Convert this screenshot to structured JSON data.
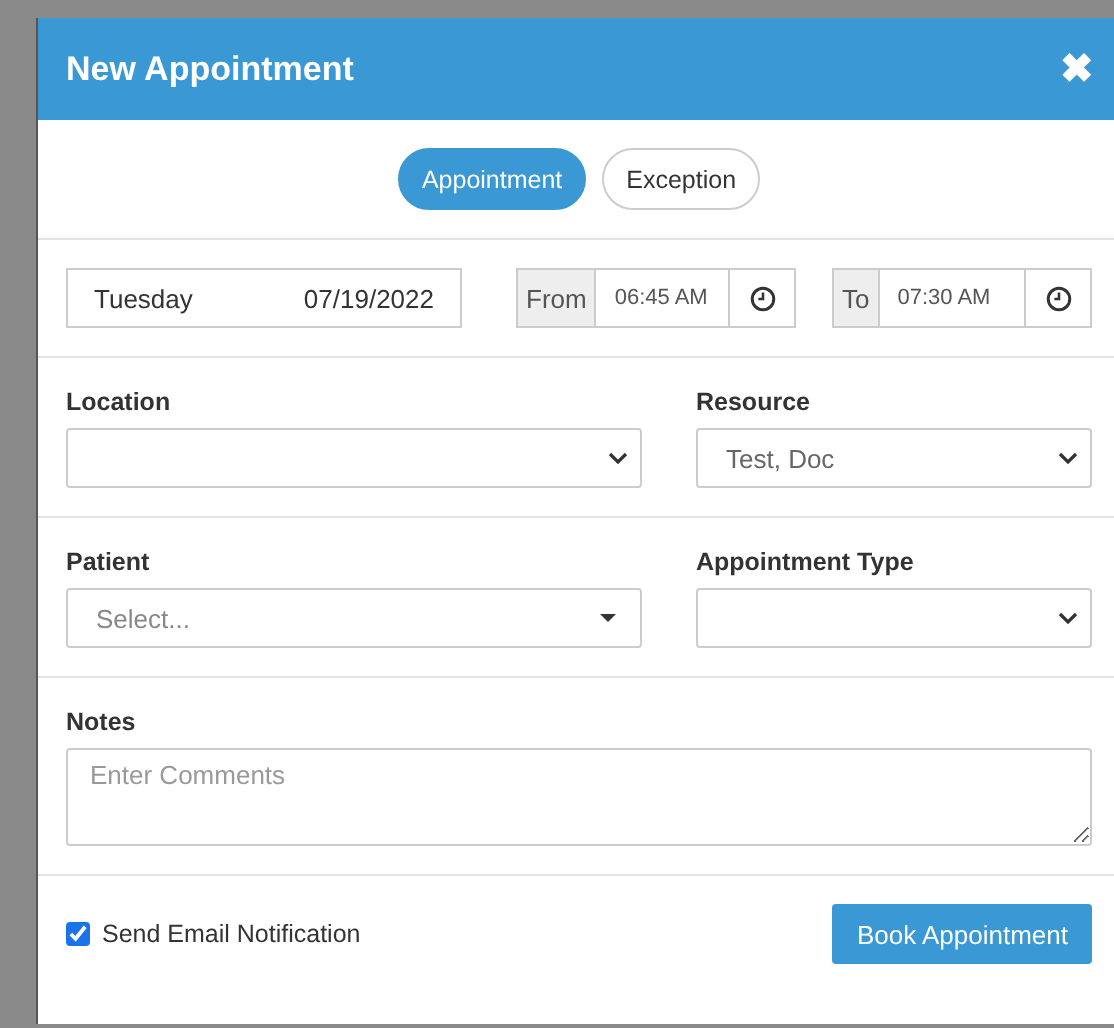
{
  "dialog": {
    "title": "New Appointment",
    "close": "✖"
  },
  "tabs": [
    {
      "label": "Appointment",
      "selected": true
    },
    {
      "label": "Exception",
      "selected": false
    }
  ],
  "date": {
    "day": "Tuesday",
    "value": "07/19/2022"
  },
  "times": [
    {
      "label": "From",
      "value": "06:45 AM"
    },
    {
      "label": "To",
      "value": "07:30 AM"
    }
  ],
  "rows": [
    [
      {
        "label": "Location",
        "kind": "select"
      },
      {
        "label": "Resource",
        "value": "Test, Doc",
        "kind": "select"
      }
    ],
    [
      {
        "label": "Patient",
        "placeholder": "Select...",
        "kind": "combo"
      },
      {
        "label": "Appointment Type",
        "kind": "select"
      }
    ]
  ],
  "notes": {
    "label": "Notes",
    "placeholder": "Enter Comments"
  },
  "email_notification": {
    "label": "Send Email Notification",
    "checked": true
  },
  "book_button": "Book Appointment"
}
